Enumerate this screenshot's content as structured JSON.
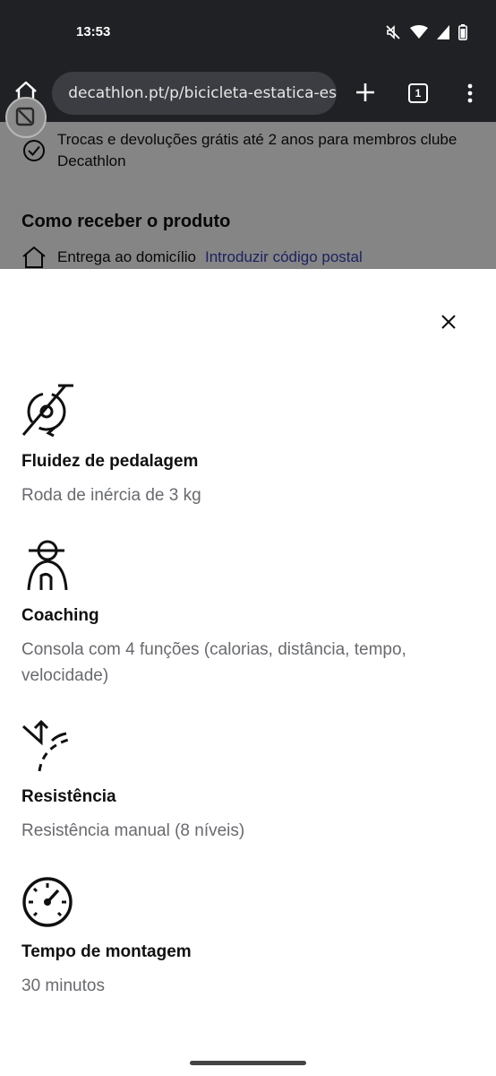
{
  "status_bar": {
    "time": "13:53",
    "icons": [
      "mute-icon",
      "wifi-icon",
      "signal-icon",
      "battery-icon"
    ]
  },
  "browser": {
    "url": "decathlon.pt/p/bicicleta-estatica-es",
    "tab_count": "1"
  },
  "page": {
    "returns_text": "Trocas e devoluções grátis até 2 anos para membros clube Decathlon",
    "delivery_heading": "Como receber o produto",
    "home_delivery_label": "Entrega ao domicílio",
    "postal_code_link": "Introduzir código postal"
  },
  "sheet": {
    "features": [
      {
        "icon": "flywheel-icon",
        "title": "Fluidez de pedalagem",
        "description": "Roda de inércia de 3 kg"
      },
      {
        "icon": "coach-icon",
        "title": "Coaching",
        "description": "Consola com 4 funções (calorias, distância, tempo, velocidade)"
      },
      {
        "icon": "resistance-icon",
        "title": "Resistência",
        "description": "Resistência manual (8 níveis)"
      },
      {
        "icon": "stopwatch-icon",
        "title": "Tempo de montagem",
        "description": "30 minutos"
      }
    ]
  },
  "colors": {
    "chrome_bg": "#1f2124",
    "url_pill": "#3b3d42",
    "link": "#3643ba",
    "description": "#686a6e"
  }
}
